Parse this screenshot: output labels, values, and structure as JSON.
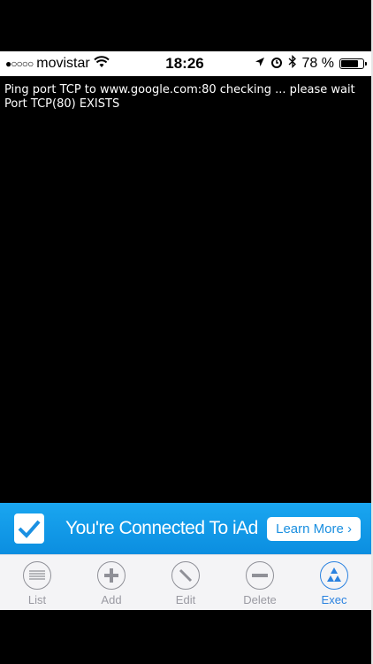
{
  "status_bar": {
    "carrier": "movistar",
    "time": "18:26",
    "battery_pct": "78 %",
    "battery_level": 0.78
  },
  "console": {
    "lines": [
      "Ping port TCP to www.google.com:80 checking ... please wait",
      "Port TCP(80) EXISTS"
    ]
  },
  "ad_banner": {
    "text": "You're Connected To iAd",
    "button_label": "Learn More ›"
  },
  "toolbar": {
    "items": [
      {
        "label": "List",
        "icon": "list-icon"
      },
      {
        "label": "Add",
        "icon": "add-icon"
      },
      {
        "label": "Edit",
        "icon": "edit-icon"
      },
      {
        "label": "Delete",
        "icon": "delete-icon"
      },
      {
        "label": "Exec",
        "icon": "exec-icon",
        "active": true
      }
    ]
  },
  "colors": {
    "accent": "#2a82e0",
    "ad_banner": "#1aa6f0"
  }
}
